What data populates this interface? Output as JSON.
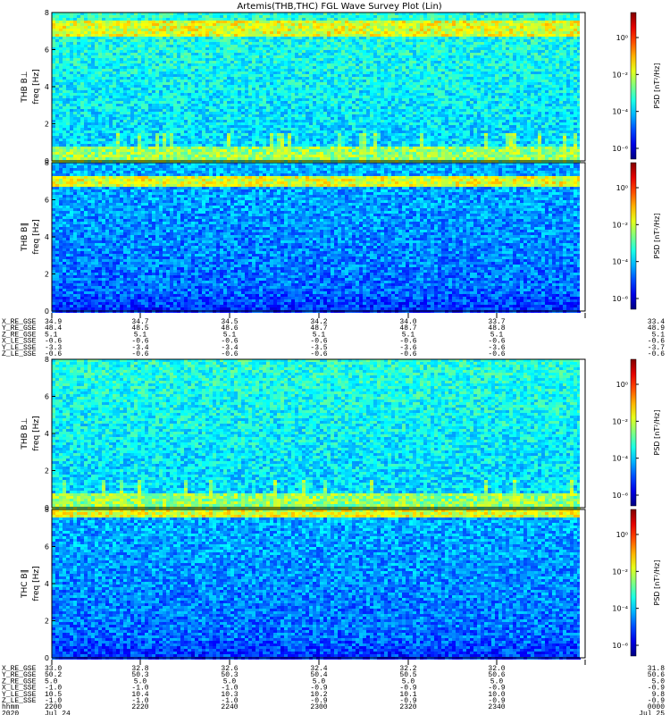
{
  "title": "Artemis(THB,THC) FGL Wave Survey Plot (Lin)",
  "colorbar_label": "PSD [nT²/Hz]",
  "colorbar_ticks": [
    "10⁰",
    "10⁻²",
    "10⁻⁴",
    "10⁻⁶"
  ],
  "chart_data": [
    {
      "type": "heatmap",
      "probe": "THB",
      "panel_label": "THB B⊥",
      "ylabel": "freq [Hz]",
      "ylim": [
        0,
        8
      ],
      "yticks": [
        "0",
        "2",
        "4",
        "6",
        "8"
      ],
      "noise_band_hz": [
        6.8,
        7.6
      ],
      "low_freq_bursts": true,
      "background_level": "medium"
    },
    {
      "type": "heatmap",
      "probe": "THB",
      "panel_label": "THB B∥",
      "ylabel": "freq [Hz]",
      "ylim": [
        0,
        8
      ],
      "yticks": [
        "0",
        "2",
        "4",
        "6",
        "8"
      ],
      "noise_band_hz": [
        6.8,
        7.4
      ],
      "low_freq_bursts": false,
      "background_level": "low"
    },
    {
      "type": "heatmap",
      "probe": "THB",
      "panel_label": "THB B⊥",
      "ylabel": "freq [Hz]",
      "ylim": [
        0,
        8
      ],
      "yticks": [
        "0",
        "2",
        "4",
        "6",
        "8"
      ],
      "noise_band_hz": null,
      "low_freq_bursts": true,
      "background_level": "medium"
    },
    {
      "type": "heatmap",
      "probe": "THC",
      "panel_label": "THC B∥",
      "ylabel": "freq [Hz]",
      "ylim": [
        0,
        8
      ],
      "yticks": [
        "0",
        "2",
        "4",
        "6",
        "8"
      ],
      "noise_band_hz": [
        7.7,
        8.0
      ],
      "low_freq_bursts": false,
      "background_level": "low"
    }
  ],
  "ephemeris_thb": {
    "rows": [
      {
        "label": "X_RE_GSE",
        "values": [
          "34.9",
          "34.7",
          "34.5",
          "34.2",
          "34.0",
          "33.7",
          "33.4"
        ]
      },
      {
        "label": "Y_RE_GSE",
        "values": [
          "48.4",
          "48.5",
          "48.6",
          "48.7",
          "48.7",
          "48.8",
          "48.9"
        ]
      },
      {
        "label": "Z_RE_GSE",
        "values": [
          "5.1",
          "5.1",
          "5.1",
          "5.1",
          "5.1",
          "5.1",
          "5.1"
        ]
      },
      {
        "label": "X_LE_SSE",
        "values": [
          "-0.6",
          "-0.6",
          "-0.6",
          "-0.6",
          "-0.6",
          "-0.6",
          "-0.6"
        ]
      },
      {
        "label": "Y_LE_SSE",
        "values": [
          "-3.3",
          "-3.4",
          "-3.4",
          "-3.5",
          "-3.6",
          "-3.6",
          "-3.7"
        ]
      },
      {
        "label": "Z_LE_SSE",
        "values": [
          "-0.6",
          "-0.6",
          "-0.6",
          "-0.6",
          "-0.6",
          "-0.6",
          "-0.6"
        ]
      }
    ]
  },
  "ephemeris_thc": {
    "rows": [
      {
        "label": "X_RE_GSE",
        "values": [
          "33.0",
          "32.8",
          "32.6",
          "32.4",
          "32.2",
          "32.0",
          "31.8"
        ]
      },
      {
        "label": "Y_RE_GSE",
        "values": [
          "50.2",
          "50.3",
          "50.3",
          "50.4",
          "50.5",
          "50.6",
          "50.6"
        ]
      },
      {
        "label": "Z_RE_GSE",
        "values": [
          "5.0",
          "5.0",
          "5.0",
          "5.0",
          "5.0",
          "5.0",
          "5.0"
        ]
      },
      {
        "label": "X_LE_SSE",
        "values": [
          "-1.0",
          "-1.0",
          "-1.0",
          "-0.9",
          "-0.9",
          "-0.9",
          "-0.9"
        ]
      },
      {
        "label": "Y_LE_SSE",
        "values": [
          "10.5",
          "10.4",
          "10.3",
          "10.2",
          "10.1",
          "10.0",
          "9.8"
        ]
      },
      {
        "label": "Z_LE_SSE",
        "values": [
          "-1.0",
          "-1.0",
          "-1.0",
          "-0.9",
          "-0.9",
          "-0.9",
          "-0.9"
        ]
      },
      {
        "label": "hhmm",
        "values": [
          "2200",
          "2220",
          "2240",
          "2300",
          "2320",
          "2340",
          "0000"
        ]
      },
      {
        "label": "2020",
        "values": [
          "Jul 24",
          "",
          "",
          "",
          "",
          "",
          "Jul 25"
        ]
      }
    ]
  }
}
